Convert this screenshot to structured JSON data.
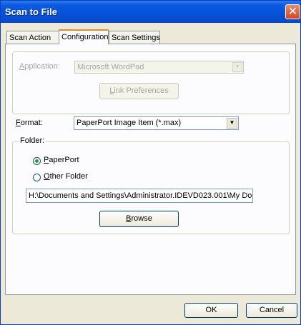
{
  "window": {
    "title": "Scan to File"
  },
  "tabs": [
    {
      "label": "Scan Action"
    },
    {
      "label": "Configuration"
    },
    {
      "label": "Scan Settings"
    }
  ],
  "application": {
    "label_u": "A",
    "label_rest": "pplication:",
    "value": "Microsoft WordPad",
    "link_prefs_u": "L",
    "link_prefs_rest": "ink Preferences"
  },
  "format": {
    "label_u": "F",
    "label_rest": "ormat:",
    "value": "PaperPort Image Item (*.max)"
  },
  "folder": {
    "group_label": "Folder:",
    "paperport_u": "P",
    "paperport_rest": "aperPort",
    "other_u": "O",
    "other_rest": "ther Folder",
    "path": "H:\\Documents and Settings\\Administrator.IDEVD023.001\\My Doc",
    "browse_u": "B",
    "browse_rest": "rowse",
    "selected": "PaperPort"
  },
  "buttons": {
    "ok": "OK",
    "cancel": "Cancel"
  },
  "colors": {
    "titlebar": "#0652d8",
    "face": "#ece9d8",
    "close": "#d2452a"
  }
}
